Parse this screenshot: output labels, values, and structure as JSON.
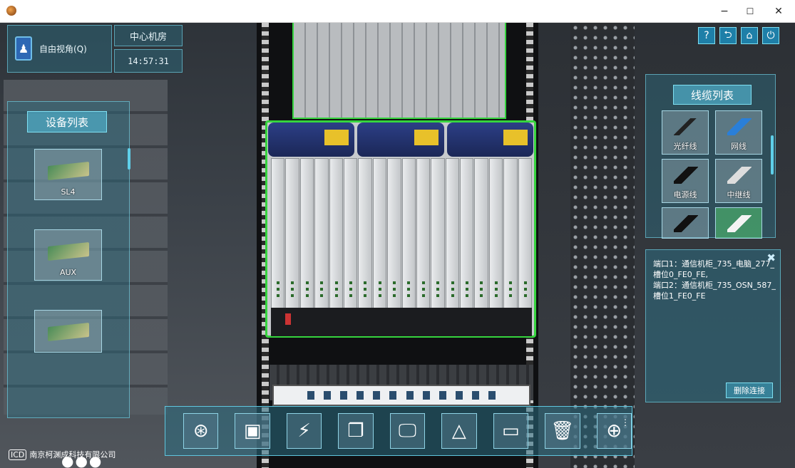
{
  "window": {
    "controls": {
      "minimize": "−",
      "maximize": "☐",
      "close": "✕"
    }
  },
  "hud": {
    "view_mode_label": "自由视角(Q)",
    "room_label": "中心机房",
    "clock": "14:57:31"
  },
  "top_right_buttons": [
    {
      "name": "help",
      "glyph": "?"
    },
    {
      "name": "back",
      "glyph": "⮌"
    },
    {
      "name": "home",
      "glyph": "⌂"
    },
    {
      "name": "power",
      "glyph": "⏻"
    }
  ],
  "device_list": {
    "title": "设备列表",
    "items": [
      {
        "label": "SL4"
      },
      {
        "label": "AUX"
      },
      {
        "label": ""
      }
    ],
    "more": "●●●"
  },
  "cable_list": {
    "title": "线缆列表",
    "items": [
      {
        "label": "光纤线"
      },
      {
        "label": "网线"
      },
      {
        "label": "电源线"
      },
      {
        "label": "中继线"
      },
      {
        "label": ""
      },
      {
        "label": ""
      }
    ]
  },
  "connection_info": {
    "port1": "端口1：通信机柜_735_电脑_277_槽位0_FE0_FE,",
    "port2": "端口2：通信机柜_735_OSN_587_槽位1_FE0_FE",
    "close": "✖",
    "delete_label": "删除连接"
  },
  "toolbar": {
    "tools": [
      {
        "name": "lifebuoy",
        "glyph": "⊛"
      },
      {
        "name": "chip",
        "glyph": "▣"
      },
      {
        "name": "plug",
        "glyph": "⚡"
      },
      {
        "name": "window",
        "glyph": "❐"
      },
      {
        "name": "monitor",
        "glyph": "🖵"
      },
      {
        "name": "cone",
        "glyph": "△"
      },
      {
        "name": "save",
        "glyph": "▭"
      },
      {
        "name": "trash",
        "glyph": "🗑"
      },
      {
        "name": "globe",
        "glyph": "⊕"
      }
    ],
    "more": "⋮"
  },
  "logo": {
    "mark": "ICD",
    "text": "南京柯渊成科技有限公司"
  },
  "colors": {
    "accent": "#38c8e0",
    "highlight": "#36d43e"
  }
}
